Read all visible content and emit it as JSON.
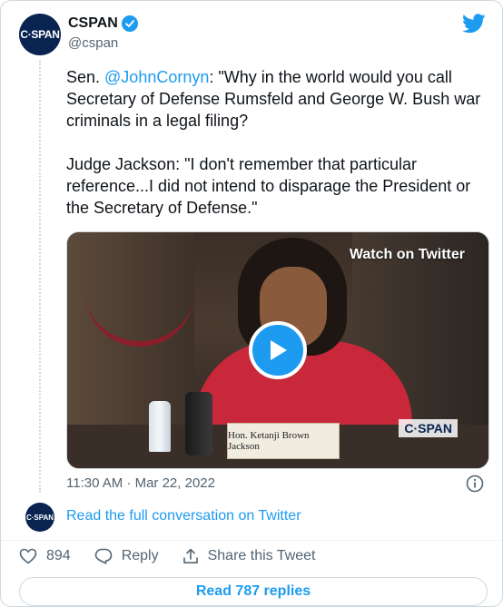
{
  "author": {
    "display_name": "CSPAN",
    "handle": "@cspan",
    "avatar_text": "C·SPAN"
  },
  "tweet": {
    "line1_prefix": "Sen. ",
    "mention": "@JohnCornyn",
    "line1_rest": ": \"Why in the world would you call Secretary of Defense Rumsfeld and George W. Bush war criminals in a legal filing?",
    "paragraph2": "Judge Jackson: \"I don't remember that particular reference...I did not intend to disparage the President or the Secretary of Defense.\""
  },
  "media": {
    "watch_label": "Watch on Twitter",
    "nameplate": "Hon. Ketanji Brown Jackson",
    "network_bug": "C·SPAN"
  },
  "meta": {
    "timestamp": "11:30 AM · Mar 22, 2022"
  },
  "conversation": {
    "link_text": "Read the full conversation on Twitter",
    "avatar_text": "C·SPAN"
  },
  "actions": {
    "likes": "894",
    "reply_label": "Reply",
    "share_label": "Share this Tweet"
  },
  "footer": {
    "read_replies": "Read 787 replies"
  },
  "colors": {
    "accent": "#1d9bf0",
    "avatar_bg": "#0a2451",
    "text_secondary": "#536471"
  }
}
